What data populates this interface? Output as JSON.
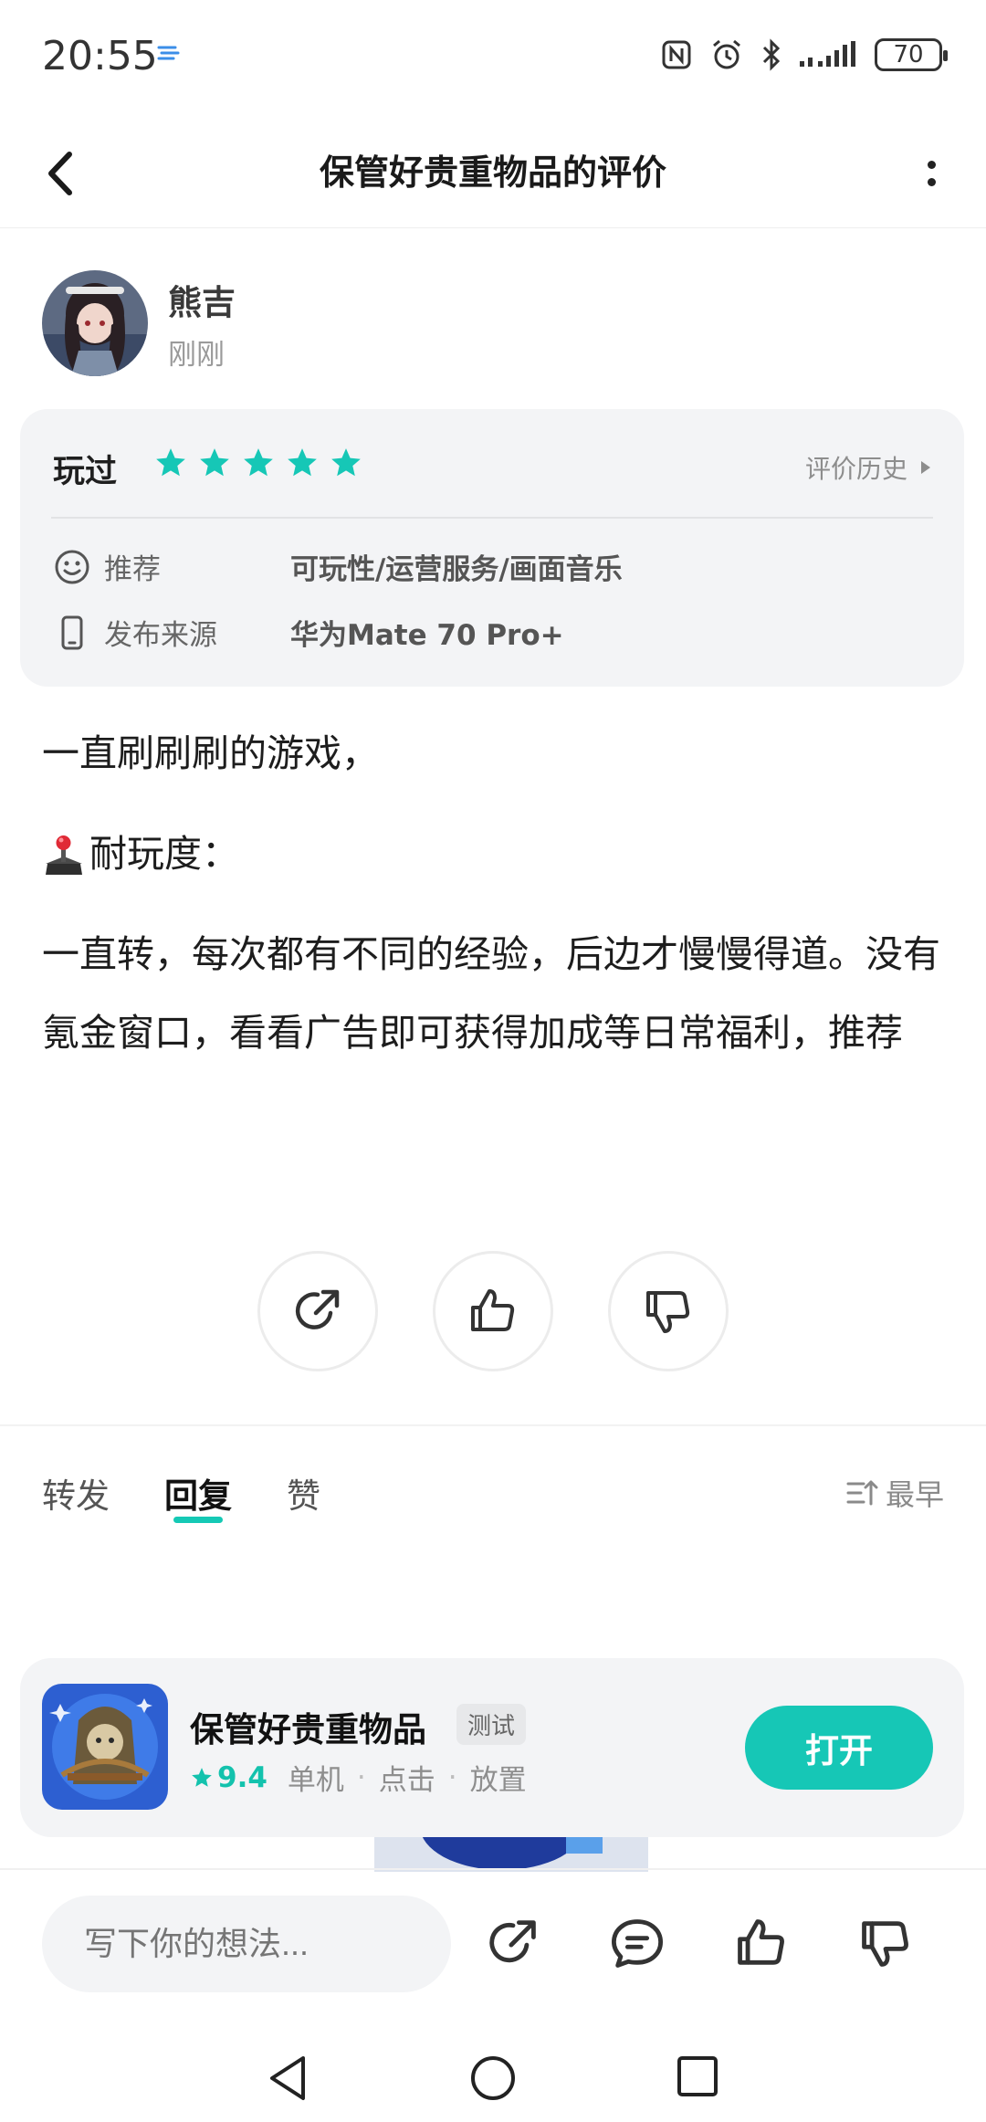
{
  "status_bar": {
    "time": "20:55",
    "battery": "70"
  },
  "header": {
    "title": "保管好贵重物品的评价"
  },
  "user": {
    "name": "熊吉",
    "time": "刚刚"
  },
  "review": {
    "played_label": "玩过",
    "stars": 5,
    "history_label": "评价历史",
    "recommend_label": "推荐",
    "recommend_value": "可玩性/运营服务/画面音乐",
    "source_label": "发布来源",
    "source_value": "华为Mate 70 Pro+"
  },
  "content": {
    "line1": "一直刷刷刷的游戏，",
    "heading": "耐玩度：",
    "paragraph": "一直转，每次都有不同的经验，后边才慢慢得道。没有氪金窗口，看看广告即可获得加成等日常福利，推荐"
  },
  "tabs": [
    {
      "label": "转发",
      "active": false
    },
    {
      "label": "回复",
      "active": true
    },
    {
      "label": "赞",
      "active": false
    }
  ],
  "sort_label": "最早",
  "game": {
    "name": "保管好贵重物品",
    "badge": "测试",
    "rating": "9.4",
    "tags": [
      "单机",
      "点击",
      "放置"
    ],
    "open_label": "打开"
  },
  "bottom_bar": {
    "placeholder": "写下你的想法..."
  },
  "colors": {
    "accent": "#16c7b6",
    "card_bg": "#f3f4f6"
  },
  "icons": [
    "back-icon",
    "more-icon",
    "smile-icon",
    "phone-icon",
    "share-icon",
    "thumb-up-icon",
    "thumb-down-icon",
    "comment-icon",
    "sort-icon",
    "star-icon"
  ]
}
